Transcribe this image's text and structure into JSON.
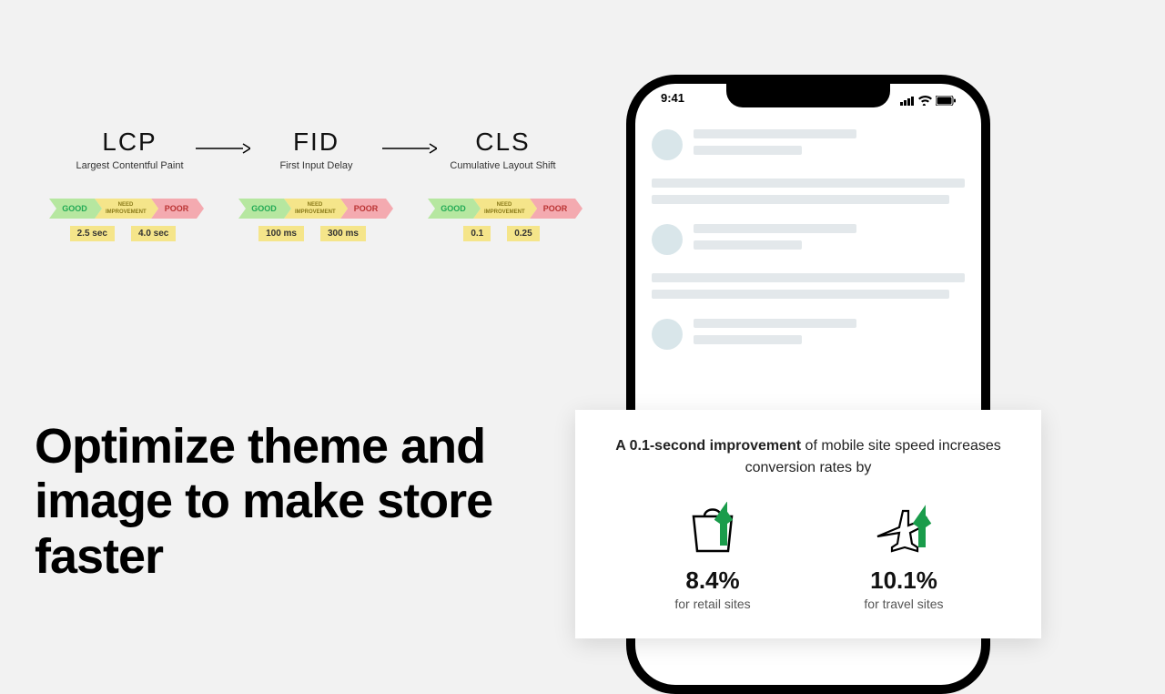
{
  "metrics": [
    {
      "abbr": "LCP",
      "full": "Largest Contentful Paint",
      "good": "GOOD",
      "need_l1": "NEED",
      "need_l2": "IMPROVEMENT",
      "poor": "POOR",
      "t1": "2.5 sec",
      "t2": "4.0 sec"
    },
    {
      "abbr": "FID",
      "full": "First Input Delay",
      "good": "GOOD",
      "need_l1": "NEED",
      "need_l2": "IMPROVEMENT",
      "poor": "POOR",
      "t1": "100 ms",
      "t2": "300 ms"
    },
    {
      "abbr": "CLS",
      "full": "Cumulative Layout Shift",
      "good": "GOOD",
      "need_l1": "NEED",
      "need_l2": "IMPROVEMENT",
      "poor": "POOR",
      "t1": "0.1",
      "t2": "0.25"
    }
  ],
  "headline": "Optimize theme and image to make store faster",
  "phone": {
    "time": "9:41"
  },
  "card": {
    "bold": "A 0.1-second improvement",
    "rest": " of mobile site speed increases conversion rates by",
    "col1_num": "8.4%",
    "col1_label": "for retail sites",
    "col2_num": "10.1%",
    "col2_label": "for travel sites"
  }
}
